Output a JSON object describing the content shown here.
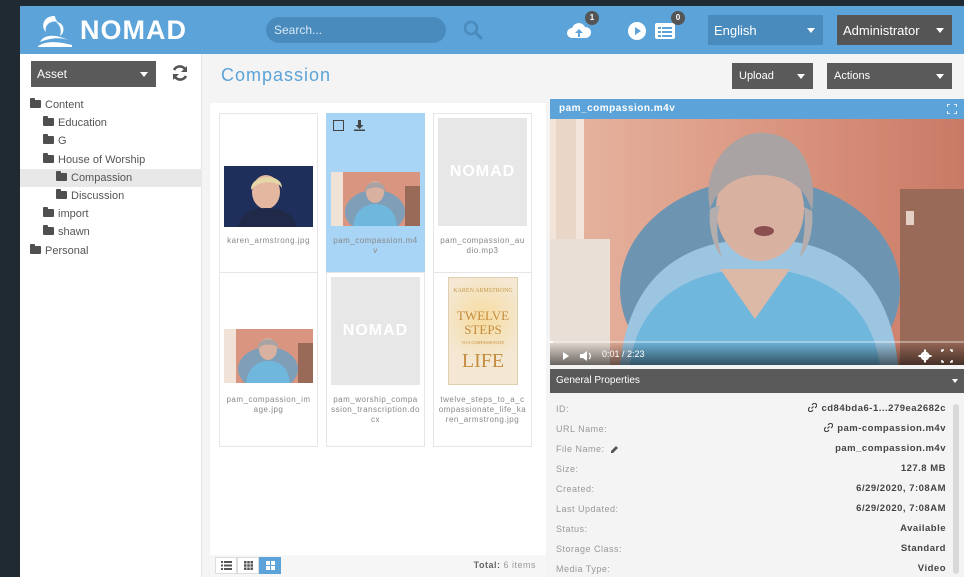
{
  "app": {
    "name": "NOMAD"
  },
  "colors": {
    "accent": "#5ba3d8",
    "dark": "#5a5a5a",
    "selected": "#a8d4f5"
  },
  "header": {
    "search_placeholder": "Search...",
    "upload_queue_count": "1",
    "media_queue_count": "0",
    "language": "English",
    "user": "Administrator"
  },
  "sidebar": {
    "type_select": "Asset",
    "tree": [
      {
        "label": "Content",
        "depth": 0
      },
      {
        "label": "Education",
        "depth": 1
      },
      {
        "label": "G",
        "depth": 1
      },
      {
        "label": "House of Worship",
        "depth": 1
      },
      {
        "label": "Compassion",
        "depth": 2,
        "active": true
      },
      {
        "label": "Discussion",
        "depth": 2
      },
      {
        "label": "import",
        "depth": 1
      },
      {
        "label": "shawn",
        "depth": 1
      },
      {
        "label": "Personal",
        "depth": 0
      }
    ]
  },
  "main": {
    "title": "Compassion",
    "upload_label": "Upload",
    "actions_label": "Actions",
    "placeholder_logo": "NOMAD",
    "items": [
      {
        "name": "karen_armstrong.jpg",
        "kind": "photo-woman-dark"
      },
      {
        "name": "pam_compassion.m4v",
        "kind": "video",
        "selected": true
      },
      {
        "name": "pam_compassion_audio.mp3",
        "kind": "placeholder"
      },
      {
        "name": "pam_compassion_image.jpg",
        "kind": "photo-woman-room"
      },
      {
        "name": "pam_worship_compassion_transcription.docx",
        "kind": "placeholder"
      },
      {
        "name": "twelve_steps_to_a_compassionate_life_karen_armstrong.jpg",
        "kind": "book"
      }
    ],
    "book_cover": {
      "author": "KAREN ARMSTRONG",
      "line1": "TWELVE",
      "line2": "STEPS",
      "line3": "TO A COMPASSIONATE",
      "line4": "LIFE"
    },
    "total_label": "Total:",
    "total_value": "6 items"
  },
  "preview": {
    "filename": "pam_compassion.m4v",
    "time": "0:01 / 2:23",
    "progress_fraction": 0.007
  },
  "properties": {
    "title": "General Properties",
    "rows": [
      {
        "key": "ID:",
        "value": "cd84bda6-1...279ea2682c",
        "icon": "link"
      },
      {
        "key": "URL Name:",
        "value": "pam-compassion.m4v",
        "icon": "link"
      },
      {
        "key": "File Name:",
        "value": "pam_compassion.m4v",
        "icon": "pencil"
      },
      {
        "key": "Size:",
        "value": "127.8 MB"
      },
      {
        "key": "Created:",
        "value": "6/29/2020, 7:08AM"
      },
      {
        "key": "Last Updated:",
        "value": "6/29/2020, 7:08AM"
      },
      {
        "key": "Status:",
        "value": "Available"
      },
      {
        "key": "Storage Class:",
        "value": "Standard"
      },
      {
        "key": "Media Type:",
        "value": "Video"
      }
    ]
  }
}
